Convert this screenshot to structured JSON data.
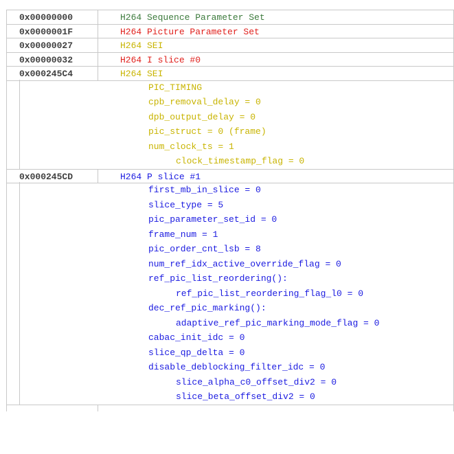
{
  "rows": [
    {
      "offset": "0x00000000",
      "name": "H264 Sequence Parameter Set",
      "color": "#3c7a3c"
    },
    {
      "offset": "0x0000001F",
      "name": "H264 Picture Parameter Set",
      "color": "#e0201c"
    },
    {
      "offset": "0x00000027",
      "name": "H264 SEI",
      "color": "#c8b400"
    },
    {
      "offset": "0x00000032",
      "name": "H264 I slice #0",
      "color": "#e0201c"
    },
    {
      "offset": "0x000245C4",
      "name": "H264 SEI",
      "color": "#c8b400",
      "details": [
        "PIC_TIMING",
        "cpb_removal_delay = 0",
        "dpb_output_delay = 0",
        "pic_struct = 0 (frame)",
        "num_clock_ts = 1",
        "clock_timestamp_flag = 0"
      ]
    },
    {
      "offset": "0x000245CD",
      "name": "H264 P slice #1",
      "color": "#1a1ae0",
      "details": [
        "first_mb_in_slice = 0",
        "slice_type = 5",
        "pic_parameter_set_id = 0",
        "frame_num = 1",
        "pic_order_cnt_lsb = 8",
        "num_ref_idx_active_override_flag = 0",
        "ref_pic_list_reordering():",
        "ref_pic_list_reordering_flag_l0 = 0",
        "dec_ref_pic_marking():",
        "adaptive_ref_pic_marking_mode_flag = 0",
        "cabac_init_idc = 0",
        "slice_qp_delta = 0",
        "disable_deblocking_filter_idc = 0",
        "slice_alpha_c0_offset_div2 = 0",
        "slice_beta_offset_div2 = 0"
      ]
    }
  ]
}
